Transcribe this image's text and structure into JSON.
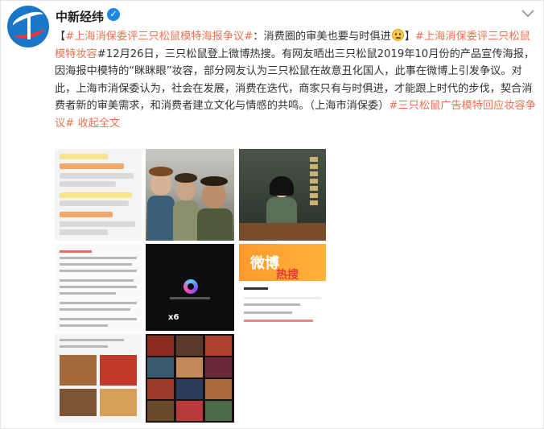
{
  "author": {
    "name": "中新经纬",
    "verified": true
  },
  "post": {
    "tag1": "#上海消保委评三只松鼠模特海报争议#",
    "text1": "：消费圈的审美也要与时俱进",
    "text1_end": "】",
    "tag2": "#上海消保委评三只松鼠模特妆容",
    "text2": "#12月26日，三只松鼠登上微博热搜。有网友晒出三只松鼠2019年10月份的产品宣传海报，因海报中模特的“眯眯眼”妆容，部分网友认为三只松鼠在故意丑化国人，此事在微博上引发争议。对此，上海市消保委认为，社会在发展，消费在迭代，商家只有与时俱进，才能跟上时代的步伐，契合消费者新的审美需求，和消费者建立文化与情感的共鸣。（上海市消保委）",
    "tag3": "#三只松鼠广告模特回应妆容争议#",
    "collapse": "收起全文"
  },
  "thumbs": {
    "hot_banner_1": "微博",
    "hot_banner_2": "热搜",
    "app_badge": "x6"
  },
  "colors": {
    "accent": "#eb7350",
    "verified": "#1e88e5"
  }
}
